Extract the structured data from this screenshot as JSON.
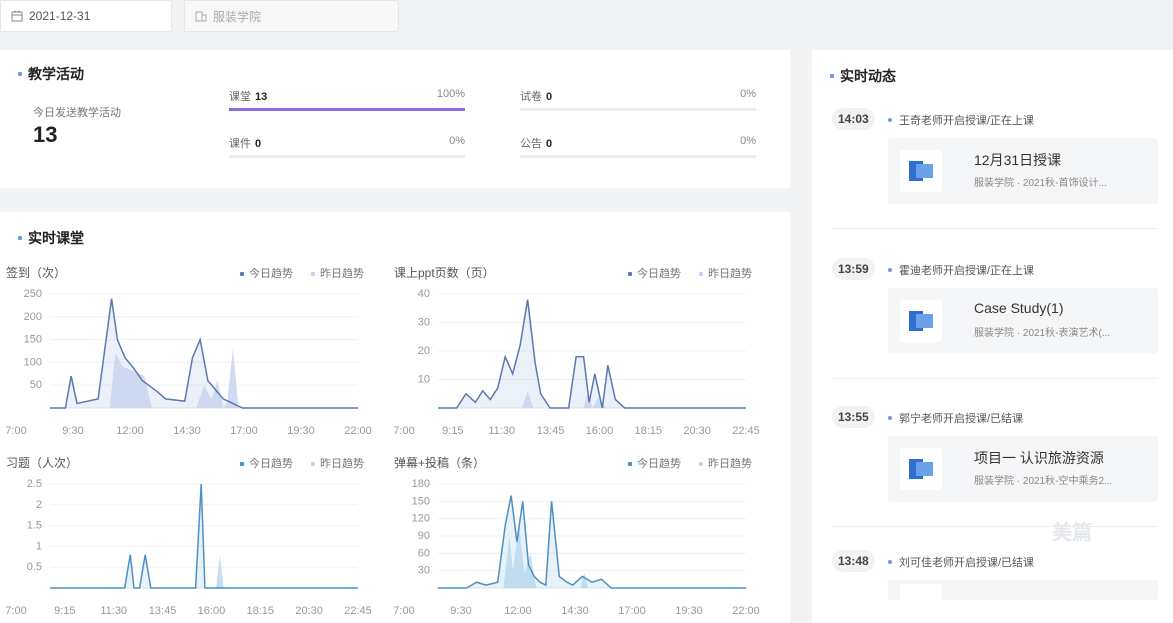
{
  "filters": {
    "date": "2021-12-31",
    "college": "服装学院"
  },
  "teaching": {
    "title": "教学活动",
    "today_label": "今日发送教学活动",
    "today_count": "13",
    "stats": [
      {
        "label": "课堂",
        "value": "13",
        "percent": "100%",
        "fraction": 1.0
      },
      {
        "label": "试卷",
        "value": "0",
        "percent": "0%",
        "fraction": 0
      },
      {
        "label": "课件",
        "value": "0",
        "percent": "0%",
        "fraction": 0
      },
      {
        "label": "公告",
        "value": "0",
        "percent": "0%",
        "fraction": 0
      }
    ]
  },
  "realtime_class": {
    "title": "实时课堂"
  },
  "legend": {
    "today": "今日趋势",
    "yesterday": "昨日趋势"
  },
  "colors": {
    "line": "#5c78b0",
    "area": "#c9d3ef",
    "accent_bar": "#8c6de0",
    "teal_line": "#4f8fc2",
    "teal_area": "#b9d9ef"
  },
  "chart_data": [
    {
      "type": "area",
      "title": "签到（次）",
      "yticks": [
        "250",
        "200",
        "150",
        "100",
        "50"
      ],
      "ylim": [
        0,
        250
      ],
      "xticks": [
        "7:00",
        "9:30",
        "12:00",
        "14:30",
        "17:00",
        "19:30",
        "22:00"
      ],
      "xlim": [
        7,
        23
      ],
      "series": [
        {
          "name": "今日趋势",
          "x": [
            7,
            7.8,
            8.1,
            8.4,
            9.5,
            10.2,
            10.5,
            10.9,
            11.3,
            11.8,
            12.6,
            13,
            14,
            14.4,
            14.8,
            15.2,
            15.6,
            16,
            17,
            23
          ],
          "y": [
            0,
            0,
            70,
            10,
            20,
            240,
            150,
            110,
            90,
            60,
            35,
            20,
            15,
            110,
            150,
            60,
            40,
            20,
            0,
            0
          ]
        },
        {
          "name": "昨日趋势",
          "x": [
            10.1,
            10.4,
            10.8,
            11.4,
            11.9,
            12.3,
            14.6,
            15,
            15.4,
            15.7,
            16,
            16.2,
            16.5,
            16.8,
            17
          ],
          "y": [
            0,
            120,
            90,
            80,
            70,
            0,
            0,
            50,
            20,
            60,
            0,
            10,
            130,
            0,
            0
          ]
        }
      ]
    },
    {
      "type": "area",
      "title": "课上ppt页数（页）",
      "yticks": [
        "40",
        "30",
        "20",
        "10"
      ],
      "ylim": [
        0,
        40
      ],
      "xticks": [
        "7:00",
        "9:15",
        "11:30",
        "13:45",
        "16:00",
        "18:15",
        "20:30",
        "22:45"
      ],
      "xlim": [
        7,
        23.5
      ],
      "series": [
        {
          "name": "今日趋势",
          "x": [
            7,
            8,
            8.5,
            9,
            9.4,
            9.8,
            10.2,
            10.6,
            11,
            11.4,
            11.8,
            12.2,
            12.5,
            13,
            14,
            14.4,
            14.8,
            15.1,
            15.4,
            15.8,
            16.1,
            16.5,
            17,
            23.5
          ],
          "y": [
            0,
            0,
            5,
            2,
            6,
            3,
            7,
            18,
            12,
            22,
            38,
            16,
            5,
            0,
            0,
            18,
            18,
            2,
            12,
            0,
            15,
            3,
            0,
            0
          ]
        },
        {
          "name": "昨日趋势",
          "x": [
            11.5,
            11.8,
            12.1,
            14.8,
            15,
            15.3,
            15.6,
            16,
            23.5
          ],
          "y": [
            0,
            6,
            0,
            0,
            5,
            0,
            4,
            0,
            0
          ]
        }
      ]
    },
    {
      "type": "area",
      "title": "习题（人次）",
      "yticks": [
        "2.5",
        "2",
        "1.5",
        "1",
        "0.5"
      ],
      "ylim": [
        0,
        2.5
      ],
      "xticks": [
        "7:00",
        "9:15",
        "11:30",
        "13:45",
        "16:00",
        "18:15",
        "20:30",
        "22:45"
      ],
      "xlim": [
        7,
        23.5
      ],
      "series": [
        {
          "name": "今日趋势",
          "x": [
            7,
            11,
            11.3,
            11.5,
            11.8,
            12.1,
            12.4,
            12.7,
            14.8,
            15.1,
            15.3,
            15.5,
            23.5
          ],
          "y": [
            0,
            0,
            0.8,
            0,
            0,
            0.8,
            0,
            0,
            0,
            2.5,
            0,
            0,
            0
          ]
        },
        {
          "name": "昨日趋势",
          "x": [
            15.9,
            16.1,
            16.3
          ],
          "y": [
            0,
            0.8,
            0
          ]
        }
      ]
    },
    {
      "type": "area",
      "title": "弹幕+投稿（条）",
      "yticks": [
        "180",
        "150",
        "120",
        "90",
        "60",
        "30"
      ],
      "ylim": [
        0,
        180
      ],
      "xticks": [
        "7:00",
        "9:30",
        "12:00",
        "14:30",
        "17:00",
        "19:30",
        "22:00"
      ],
      "xlim": [
        7,
        23
      ],
      "series": [
        {
          "name": "今日趋势",
          "x": [
            7,
            8.5,
            9,
            9.5,
            10.1,
            10.5,
            10.8,
            11.1,
            11.4,
            11.7,
            12,
            12.3,
            12.6,
            12.9,
            13.3,
            13.7,
            14,
            14.5,
            15,
            15.5,
            16,
            23
          ],
          "y": [
            0,
            0,
            10,
            5,
            10,
            110,
            160,
            80,
            150,
            40,
            20,
            10,
            5,
            150,
            20,
            10,
            5,
            20,
            10,
            15,
            0,
            0
          ]
        },
        {
          "name": "昨日趋势",
          "x": [
            10.4,
            10.7,
            10.9,
            11.2,
            11.5,
            11.8,
            12.1,
            14.4,
            14.6,
            14.8
          ],
          "y": [
            0,
            90,
            30,
            110,
            25,
            60,
            0,
            0,
            25,
            0
          ]
        }
      ]
    }
  ],
  "feed": {
    "title": "实时动态",
    "items": [
      {
        "time": "14:03",
        "text": "王奇老师开启授课/正在上课",
        "course": "12月31日授课",
        "sub": "服装学院 · 2021秋-首饰设计..."
      },
      {
        "time": "13:59",
        "text": "霍迪老师开启授课/正在上课",
        "course": "Case Study(1)",
        "sub": "服装学院 · 2021秋-表演艺术(..."
      },
      {
        "time": "13:55",
        "text": "郭宁老师开启授课/已结课",
        "course": "项目一 认识旅游资源",
        "sub": "服装学院 · 2021秋-空中乘务2..."
      },
      {
        "time": "13:48",
        "text": "刘可佳老师开启授课/已结课",
        "course": "",
        "sub": ""
      }
    ],
    "watermark": "美篇"
  }
}
